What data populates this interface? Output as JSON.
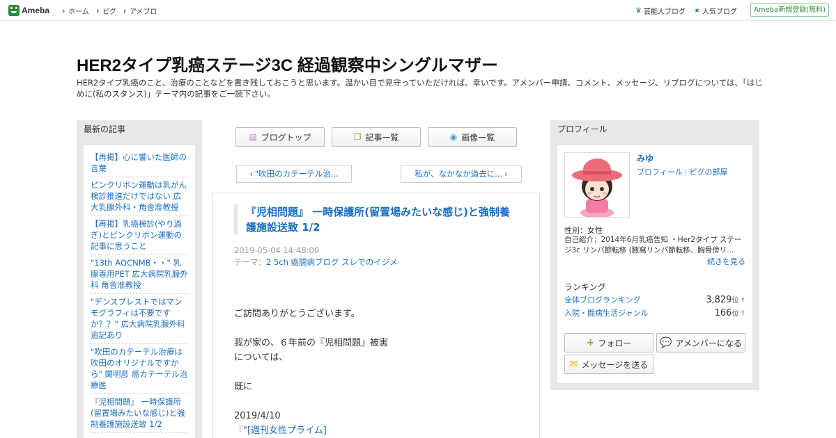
{
  "header": {
    "logo_text": "Ameba",
    "nav": [
      "ホーム",
      "ピグ",
      "アメブロ"
    ],
    "celebrity_blog": "芸能人ブログ",
    "popular_blog": "人気ブログ",
    "signup": "Ameba新規登録(無料)"
  },
  "blog": {
    "title": "HER2タイプ乳癌ステージ3C 経過観察中シングルマザー",
    "description": "HER2タイプ乳癌のこと、治療のことなどを書き残しておこうと思います。温かい目で見守っていただければ、幸いです。アメンバー申請、コメント、メッセージ、リブログについては、「はじめに(私のスタンス)」テーマ内の記事をご一読下さい。"
  },
  "left_sidebar": {
    "heading": "最新の記事",
    "recent_entries": [
      "【再掲】心に響いた医師の言葉",
      "ピンクリボン運動は乳がん検診推進だけではない 広大乳腺外科・角舎准教授",
      "【再掲】乳癌検診(やり過ぎ)とピンクリボン運動の記事に思うこと",
      "\"13th AOCNMB・・\" 乳腺専用PET 広大病院乳腺外科 角舎准教授",
      "\"デンスブレストではマンモグラフィは不要ですか？？\" 広大病院乳腺外科 追記あり",
      "\"吹田のカテーテル治療は吹田のオリジナルですから\" 関明彦 癌カテーテル治療医",
      "『児相問題』 一時保護所(留置場みたいな感じ)と強制養護施設送致 1/2"
    ]
  },
  "center": {
    "buttons": {
      "blog_top": "ブログトップ",
      "entry_list": "記事一覧",
      "image_list": "画像一覧"
    },
    "prev_entry": "\"吹田のカテーテル治...",
    "next_entry": "私が、なかなか過去に...",
    "entry": {
      "title": "『児相問題』 一時保護所(留置場みたいな感じ)と強制養護施設送致 1/2",
      "date": "2019-05-04 14:48:00",
      "theme_label": "テーマ：",
      "theme": "2 5ch 癌闘病ブログ スレでのイジメ",
      "body": {
        "p1": "ご訪問ありがとうございます。",
        "p2_line1": "我が家の、６年前の『児相問題』被害",
        "p2_line2": "については、",
        "p3": "既に",
        "p4_date": "2019/4/10",
        "p4_link_prefix": "『",
        "p4_link": "\"[週刊女性プライム]"
      }
    }
  },
  "right_sidebar": {
    "heading": "プロフィール",
    "name": "みゆ",
    "link_profile": "プロフィール",
    "link_pig": "ピグの部屋",
    "gender": "性別：女性",
    "intro": "自己紹介：2014年6月乳癌告知 ・Her2タイプ ステージ3c リンパ節転移 (腋窩リンパ節転移、胸骨傍リ...",
    "more": "続きを見る",
    "ranking_heading": "ランキング",
    "rankings": [
      {
        "label": "全体ブログランキング",
        "value": "3,829",
        "unit": "位",
        "trend": "↑"
      },
      {
        "label": "入院・闘病生活ジャンル",
        "value": "166",
        "unit": "位",
        "trend": "↑"
      }
    ],
    "follow": "フォロー",
    "amember": "アメンバーになる",
    "message": "メッセージを送る"
  },
  "colors": {
    "accent_green": "#2d8c3c",
    "link_blue": "#1a6fc0",
    "sidebar_gray": "#e8e8e8"
  }
}
